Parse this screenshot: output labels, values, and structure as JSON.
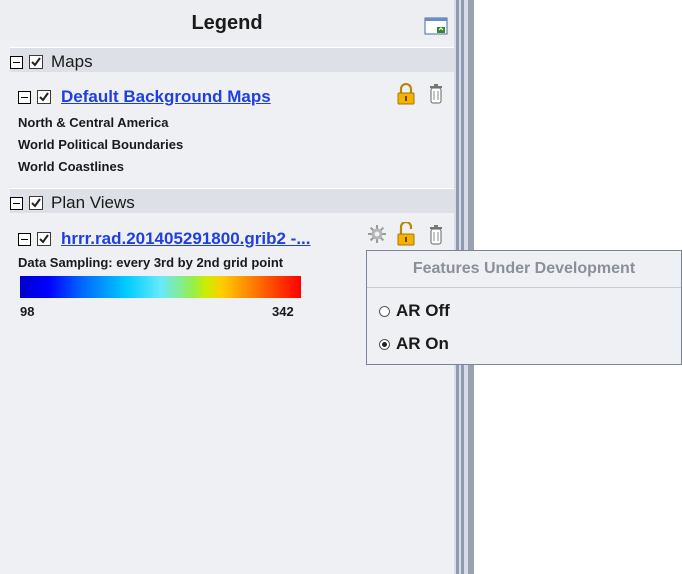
{
  "legend": {
    "title": "Legend",
    "maps_section": {
      "label": "Maps"
    },
    "default_maps": {
      "label": "Default Background Maps",
      "items": [
        "North & Central America",
        "World Political Boundaries",
        "World Coastlines"
      ]
    },
    "plan_views_section": {
      "label": "Plan Views"
    },
    "grib_layer": {
      "label": "hrrr.rad.201405291800.grib2 -...",
      "sampling_text": "Data Sampling: every 3rd by 2nd grid point",
      "colorbar_min": "98",
      "colorbar_max": "342"
    }
  },
  "popup": {
    "header": "Features Under Development",
    "options": [
      {
        "label": "AR Off",
        "selected": false
      },
      {
        "label": "AR On",
        "selected": true
      }
    ]
  },
  "colors": {
    "link": "#1f3fe0",
    "panel_bg": "#eef0f4",
    "section_bg": "#dde1e7",
    "popup_header": "#8a8f99"
  }
}
